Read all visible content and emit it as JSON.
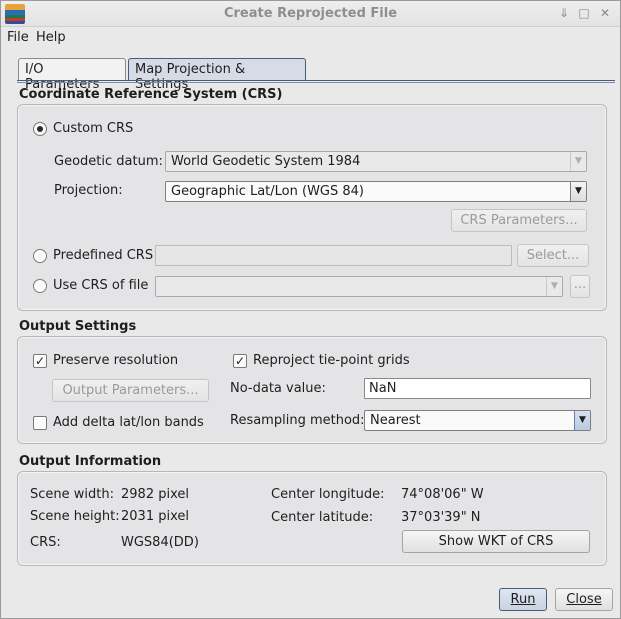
{
  "window": {
    "title": "Create Reprojected File",
    "minimize_glyph": "⇓",
    "maximize_glyph": "□",
    "close_glyph": "✕"
  },
  "menu": {
    "file": "File",
    "help": "Help"
  },
  "tabs": [
    {
      "label": "I/O Parameters",
      "active": false
    },
    {
      "label": "Map Projection & Settings",
      "active": true
    }
  ],
  "crs": {
    "section_title": "Coordinate Reference System (CRS)",
    "custom_crs_label": "Custom CRS",
    "custom_crs_selected": true,
    "geodetic_datum_label": "Geodetic datum:",
    "geodetic_datum_value": "World Geodetic System 1984",
    "projection_label": "Projection:",
    "projection_value": "Geographic Lat/Lon (WGS 84)",
    "crs_parameters_button": "CRS Parameters...",
    "predefined_crs_label": "Predefined CRS",
    "select_button": "Select...",
    "use_crs_of_file_label": "Use CRS of file",
    "browse_button": "..."
  },
  "output_settings": {
    "section_title": "Output Settings",
    "preserve_resolution_label": "Preserve resolution",
    "preserve_resolution_checked": true,
    "output_parameters_button": "Output Parameters...",
    "add_delta_label": "Add delta lat/lon bands",
    "add_delta_checked": false,
    "reproject_tie_point_label": "Reproject tie-point grids",
    "reproject_tie_point_checked": true,
    "no_data_label": "No-data value:",
    "no_data_value": "NaN",
    "resampling_label": "Resampling method:",
    "resampling_value": "Nearest"
  },
  "output_info": {
    "section_title": "Output Information",
    "scene_width_label": "Scene width:",
    "scene_width_value": "2982 pixel",
    "scene_height_label": "Scene height:",
    "scene_height_value": "2031 pixel",
    "crs_label": "CRS:",
    "crs_value": "WGS84(DD)",
    "center_lon_label": "Center longitude:",
    "center_lon_value": "74°08'06\" W",
    "center_lat_label": "Center latitude:",
    "center_lat_value": "37°03'39\" N",
    "show_wkt_button": "Show WKT of CRS"
  },
  "footer": {
    "run_button": "Run",
    "close_button": "Close"
  },
  "icons": {
    "app": "app-logo-icon",
    "dropdown": "chevron-down-icon"
  },
  "colors": {
    "accent": "#4a5b77",
    "background": "#e9e9ea"
  }
}
